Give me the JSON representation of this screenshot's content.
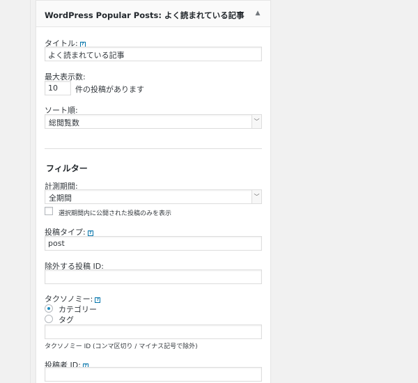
{
  "widget": {
    "title": "WordPress Popular Posts: よく読まれている記事",
    "toggle_icon": "▲"
  },
  "fields": {
    "title_label": "タイトル:",
    "title_value": "よく読まれている記事",
    "max_label": "最大表示数:",
    "max_value": "10",
    "max_suffix": "件の投稿があります",
    "sort_label": "ソート順:",
    "sort_value": "総閲覧数",
    "filter_heading": "フィルター",
    "period_label": "計測期間:",
    "period_value": "全期間",
    "period_checkbox_label": "選択期間内に公開された投稿のみを表示",
    "post_type_label": "投稿タイプ:",
    "post_type_value": "post",
    "exclude_label": "除外する投稿 ID:",
    "exclude_value": "",
    "taxonomy_label": "タクソノミー:",
    "taxonomy_options": [
      "カテゴリー",
      "タグ"
    ],
    "taxonomy_selected": "カテゴリー",
    "taxonomy_ids_value": "",
    "taxonomy_hint": "タクソノミー ID (コンマ区切り / マイナス記号で除外)",
    "author_label": "投稿者 ID:",
    "author_value": ""
  },
  "icons": {
    "help": "?",
    "select_arrow": "﹀"
  },
  "colors": {
    "accent": "#0073aa",
    "radio_dot": "#1e8cbe",
    "background": "#f1f1f1"
  }
}
